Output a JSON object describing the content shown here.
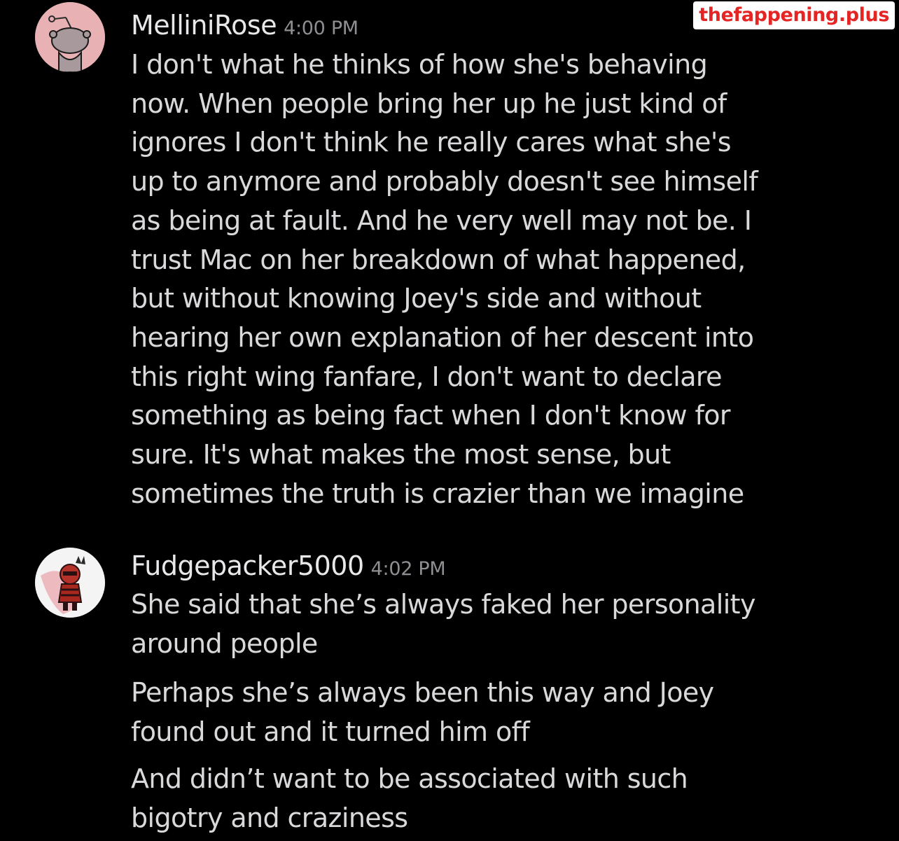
{
  "watermark": "thefappening.plus",
  "messages": [
    {
      "username": "MelliniRose",
      "time": "4:00 PM",
      "avatar_icon": "reddit-snoo-default-avatar",
      "avatar_color": "#e8b1b3",
      "paragraphs": [
        "I don't what he thinks of how she's behaving\nnow. When people bring her up he just kind of\nignores I don't think he really cares what she's\nup to anymore and probably doesn't see himself\nas being at fault. And he very well may not be. I\ntrust Mac on her breakdown of what happened,\nbut without knowing Joey's side and without\nhearing her own explanation of her descent into\nthis right wing fanfare, I don't want to declare\nsomething as being fact when I don't know for\nsure. It's what makes the most sense, but\nsometimes the truth is crazier than we imagine"
      ]
    },
    {
      "username": "Fudgepacker5000",
      "time": "4:02 PM",
      "avatar_icon": "cartoon-character-avatar",
      "avatar_color": "#f4f4f4",
      "paragraphs": [
        "She said that she’s always faked her personality\naround people",
        "Perhaps she’s always been this way and Joey\nfound out and it turned him off",
        "And didn’t want to be associated with such\nbigotry and craziness"
      ]
    }
  ]
}
